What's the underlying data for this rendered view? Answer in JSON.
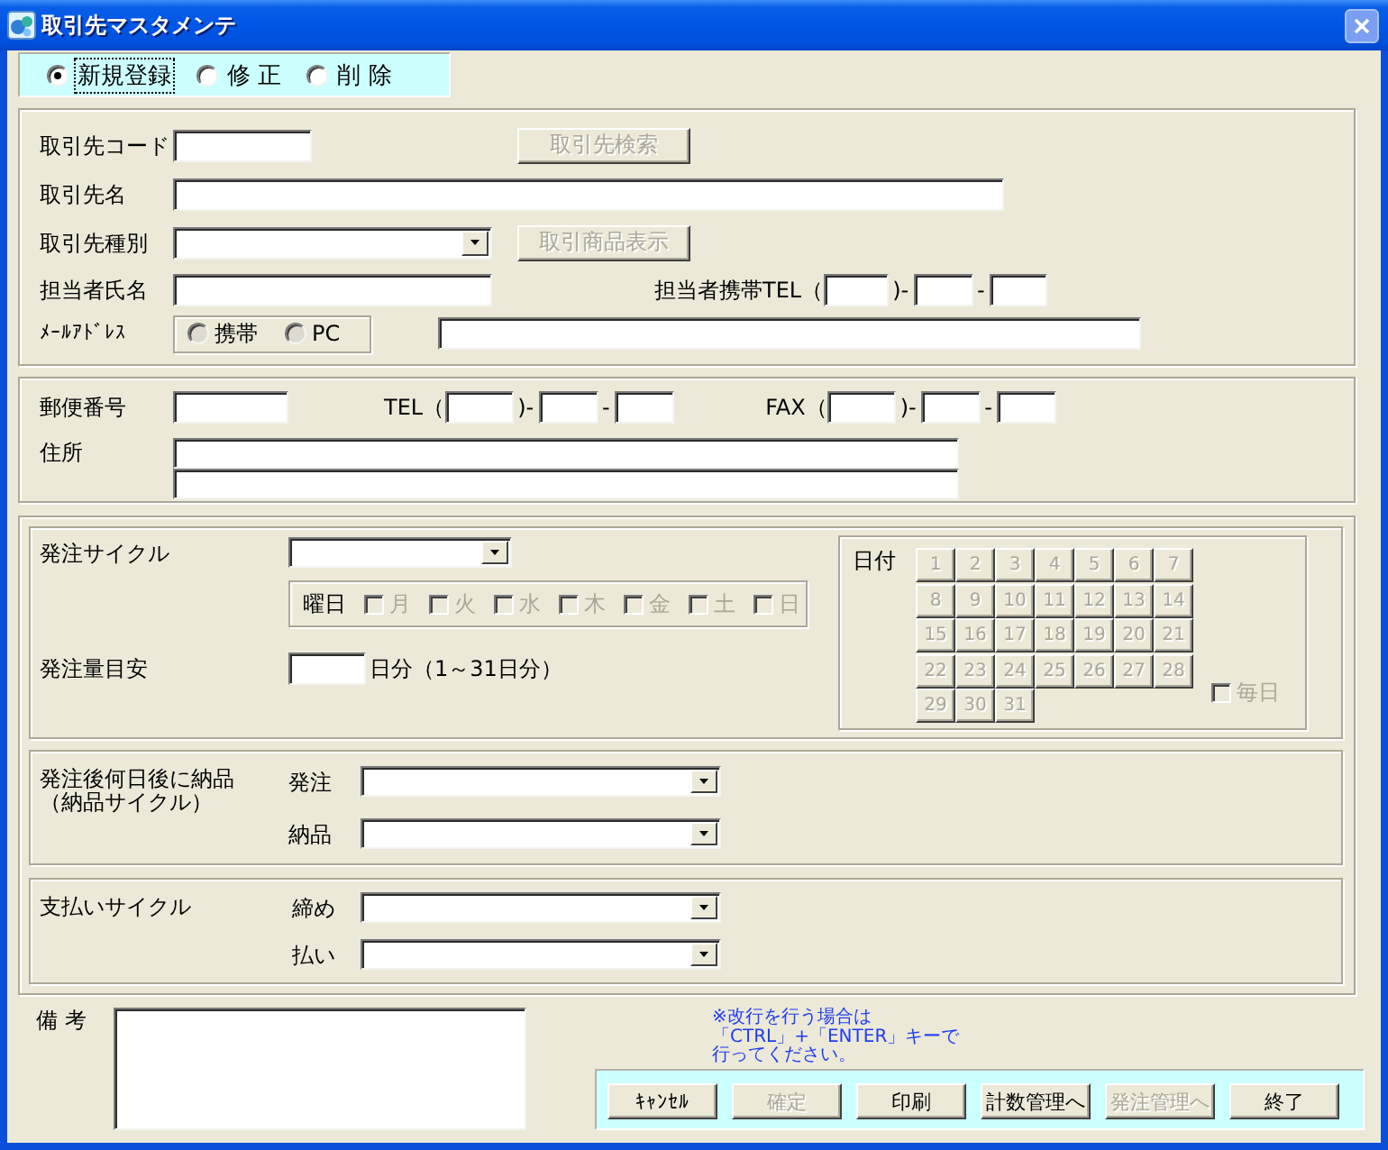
{
  "window": {
    "title": "取引先マスタメンテ",
    "close_disabled": true
  },
  "mode_options": [
    {
      "label": "新規登録",
      "selected": true,
      "focused": true
    },
    {
      "label": "修 正",
      "selected": false,
      "focused": false
    },
    {
      "label": "削 除",
      "selected": false,
      "focused": false
    }
  ],
  "client_section": {
    "code_label": "取引先コード",
    "search_button": {
      "label": "取引先検索",
      "disabled": true
    },
    "name_label": "取引先名",
    "type_label": "取引先種別",
    "products_button": {
      "label": "取引商品表示",
      "disabled": true
    },
    "contact_label": "担当者氏名",
    "mobile_tel": {
      "label": "担当者携帯TEL（",
      "separators": [
        ")-",
        "-"
      ]
    },
    "email": {
      "label": "ﾒｰﾙｱﾄﾞﾚｽ",
      "options": [
        {
          "label": "携帯",
          "selected": false,
          "disabled": true
        },
        {
          "label": "PC",
          "selected": false,
          "disabled": true
        }
      ]
    }
  },
  "address_section": {
    "postal_label": "郵便番号",
    "tel": {
      "label": "TEL（",
      "separators": [
        ")-",
        "-"
      ]
    },
    "fax": {
      "label": "FAX（",
      "separators": [
        ")-",
        "-"
      ]
    },
    "address_label": "住所"
  },
  "order_section": {
    "cycle_label": "発注サイクル",
    "weekdays": {
      "label": "曜日",
      "days": [
        {
          "label": "月",
          "checked": false,
          "disabled": true
        },
        {
          "label": "火",
          "checked": false,
          "disabled": true
        },
        {
          "label": "水",
          "checked": false,
          "disabled": true
        },
        {
          "label": "木",
          "checked": false,
          "disabled": true
        },
        {
          "label": "金",
          "checked": false,
          "disabled": true
        },
        {
          "label": "土",
          "checked": false,
          "disabled": true
        },
        {
          "label": "日",
          "checked": false,
          "disabled": true
        }
      ]
    },
    "amount": {
      "label": "発注量目安",
      "unit": "日分（1～31日分）"
    },
    "dates": {
      "label": "日付",
      "days": [
        {
          "label": "1",
          "disabled": true
        },
        {
          "label": "2",
          "disabled": true
        },
        {
          "label": "3",
          "disabled": true
        },
        {
          "label": "4",
          "disabled": true
        },
        {
          "label": "5",
          "disabled": true
        },
        {
          "label": "6",
          "disabled": true
        },
        {
          "label": "7",
          "disabled": true
        },
        {
          "label": "8",
          "disabled": true
        },
        {
          "label": "9",
          "disabled": true
        },
        {
          "label": "10",
          "disabled": true
        },
        {
          "label": "11",
          "disabled": true
        },
        {
          "label": "12",
          "disabled": true
        },
        {
          "label": "13",
          "disabled": true
        },
        {
          "label": "14",
          "disabled": true
        },
        {
          "label": "15",
          "disabled": true
        },
        {
          "label": "16",
          "disabled": true
        },
        {
          "label": "17",
          "disabled": true
        },
        {
          "label": "18",
          "disabled": true
        },
        {
          "label": "19",
          "disabled": true
        },
        {
          "label": "20",
          "disabled": true
        },
        {
          "label": "21",
          "disabled": true
        },
        {
          "label": "22",
          "disabled": true
        },
        {
          "label": "23",
          "disabled": true
        },
        {
          "label": "24",
          "disabled": true
        },
        {
          "label": "25",
          "disabled": true
        },
        {
          "label": "26",
          "disabled": true
        },
        {
          "label": "27",
          "disabled": true
        },
        {
          "label": "28",
          "disabled": true
        },
        {
          "label": "29",
          "disabled": true
        },
        {
          "label": "30",
          "disabled": true
        },
        {
          "label": "31",
          "disabled": true
        }
      ],
      "everyday": {
        "label": "毎日",
        "checked": false,
        "disabled": true
      }
    }
  },
  "delivery_section": {
    "label_lines": [
      "発注後何日後に納品",
      "（納品サイクル）"
    ],
    "selects": [
      {
        "label": "発注"
      },
      {
        "label": "納品"
      }
    ]
  },
  "payment_section": {
    "label": "支払いサイクル",
    "selects": [
      {
        "label": "締め"
      },
      {
        "label": "払い"
      }
    ]
  },
  "remarks": {
    "label": "備 考"
  },
  "note": {
    "lines": [
      "※改行を行う場合は",
      "「CTRL」+「ENTER」キーで",
      "行ってください。"
    ]
  },
  "buttons": [
    {
      "label": "ｷｬﾝｾﾙ",
      "disabled": false
    },
    {
      "label": "確定",
      "disabled": true
    },
    {
      "label": "印刷",
      "disabled": false
    },
    {
      "label": "計数管理へ",
      "disabled": false
    },
    {
      "label": "発注管理へ",
      "disabled": true
    },
    {
      "label": "終了",
      "disabled": false
    }
  ]
}
